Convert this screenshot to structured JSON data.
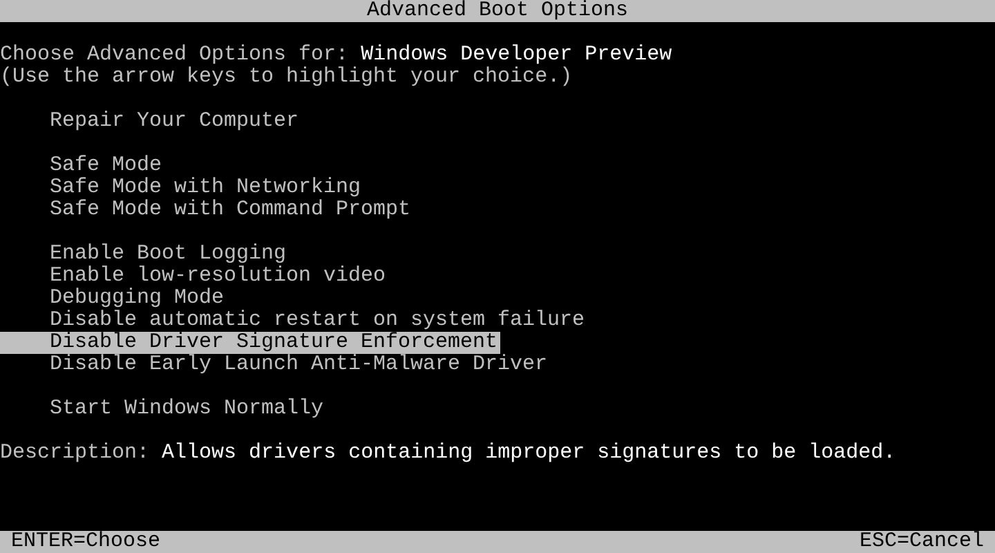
{
  "title_bar": {
    "title": "Advanced Boot Options"
  },
  "prompt": {
    "label": "Choose Advanced Options for:",
    "os_name": "Windows Developer Preview",
    "hint": "(Use the arrow keys to highlight your choice.)"
  },
  "menu_groups": [
    {
      "items": [
        {
          "label": "Repair Your Computer",
          "selected": false
        }
      ]
    },
    {
      "items": [
        {
          "label": "Safe Mode",
          "selected": false
        },
        {
          "label": "Safe Mode with Networking",
          "selected": false
        },
        {
          "label": "Safe Mode with Command Prompt",
          "selected": false
        }
      ]
    },
    {
      "items": [
        {
          "label": "Enable Boot Logging",
          "selected": false
        },
        {
          "label": "Enable low-resolution video",
          "selected": false
        },
        {
          "label": "Debugging Mode",
          "selected": false
        },
        {
          "label": "Disable automatic restart on system failure",
          "selected": false
        },
        {
          "label": "Disable Driver Signature Enforcement",
          "selected": true
        },
        {
          "label": "Disable Early Launch Anti-Malware Driver",
          "selected": false
        }
      ]
    },
    {
      "items": [
        {
          "label": "Start Windows Normally",
          "selected": false
        }
      ]
    }
  ],
  "description": {
    "label": "Description:",
    "text": "Allows drivers containing improper signatures to be loaded."
  },
  "status_bar": {
    "left": "ENTER=Choose",
    "right": "ESC=Cancel"
  }
}
